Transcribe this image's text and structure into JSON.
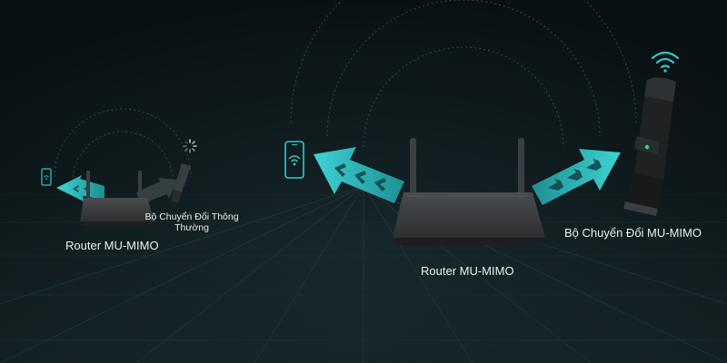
{
  "labels": {
    "left_router": "Router MU-MIMO",
    "left_adapter": "Bộ Chuyển Đổi Thông Thường",
    "center_router": "Router MU-MIMO",
    "right_adapter": "Bộ Chuyển Đổi MU-MIMO"
  },
  "icons": {
    "phone": "phone-wifi-icon",
    "wifi": "wifi-signal-icon",
    "loading": "loading-spinner-icon"
  },
  "colors": {
    "background": "#0c1416",
    "accent_cyan": "#33c8c8",
    "device_body": "#3a3d40",
    "label_text": "#e8eef0"
  }
}
